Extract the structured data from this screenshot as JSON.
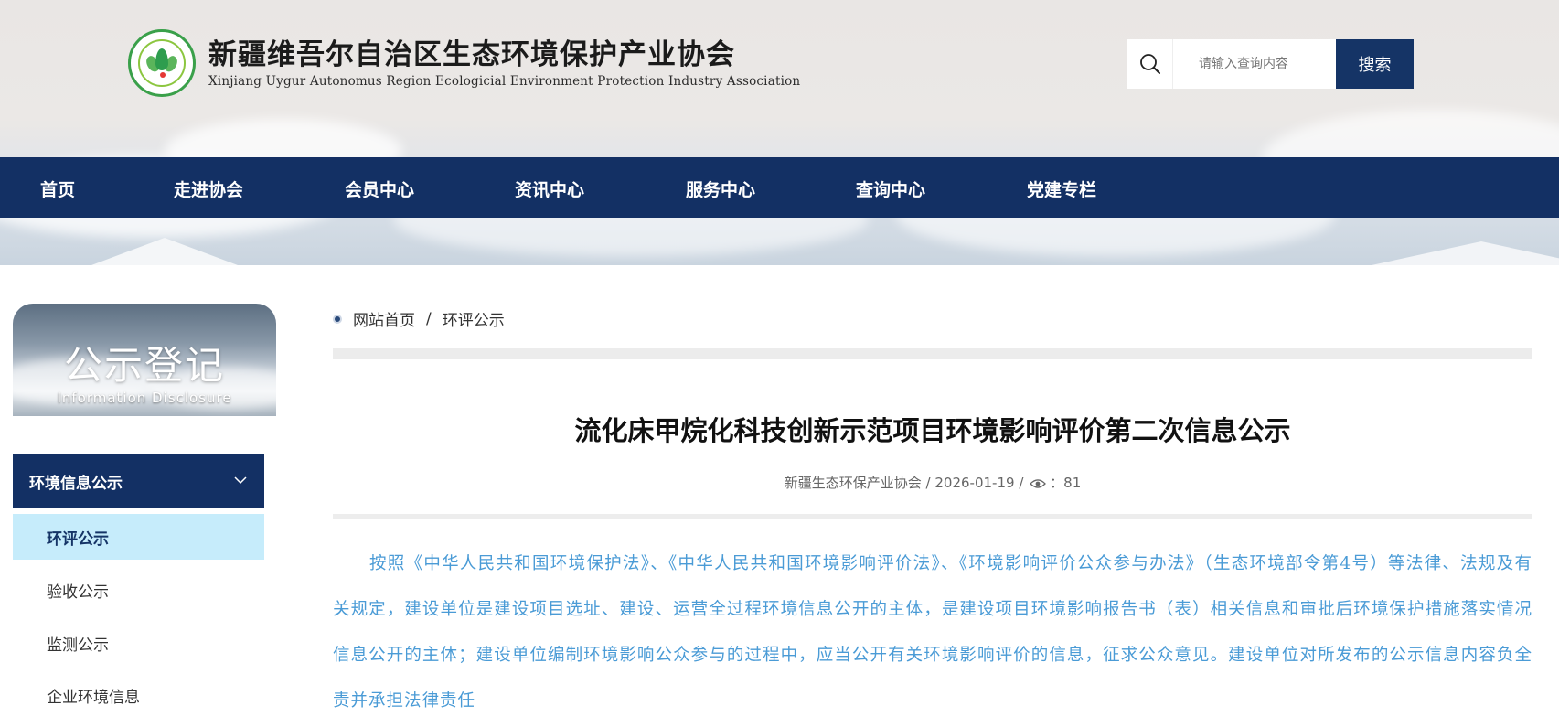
{
  "header": {
    "org_name_cn": "新疆维吾尔自治区生态环境保护产业协会",
    "org_name_en": "Xinjiang Uygur Autonomus Region Ecologicial Environment Protection Industry Association",
    "logo_ring_text": "XEEPIA",
    "search": {
      "placeholder": "请输入查询内容",
      "button_label": "搜索"
    }
  },
  "nav": {
    "items": [
      {
        "label": "首页"
      },
      {
        "label": "走进协会"
      },
      {
        "label": "会员中心"
      },
      {
        "label": "资讯中心"
      },
      {
        "label": "服务中心"
      },
      {
        "label": "查询中心"
      },
      {
        "label": "党建专栏"
      }
    ]
  },
  "sidebar": {
    "hero_title": "公示登记",
    "hero_subtitle": "Information Disclosure",
    "section_label": "环境信息公示",
    "items": [
      {
        "label": "环评公示",
        "active": true
      },
      {
        "label": "验收公示",
        "active": false
      },
      {
        "label": "监测公示",
        "active": false
      },
      {
        "label": "企业环境信息",
        "active": false
      }
    ]
  },
  "breadcrumb": {
    "home": "网站首页",
    "separator": "/",
    "current": "环评公示"
  },
  "article": {
    "title": "流化床甲烷化科技创新示范项目环境影响评价第二次信息公示",
    "source": "新疆生态环保产业协会",
    "meta_sep": "/",
    "date": "2026-01-19",
    "views_label": "：81",
    "body": "按照《中华人民共和国环境保护法》、《中华人民共和国环境影响评价法》、《环境影响评价公众参与办法》（生态环境部令第4号）等法律、法规及有关规定，建设单位是建设项目选址、建设、运营全过程环境信息公开的主体，是建设项目环境影响报告书（表）相关信息和审批后环境保护措施落实情况信息公开的主体；建设单位编制环境影响公众参与的过程中，应当公开有关环境影响评价的信息，征求公众意见。建设单位对所发布的公示信息内容负全责并承担法律责任"
  },
  "colors": {
    "nav_bg": "#133064",
    "active_item_bg": "#c6ecfb",
    "body_text": "#4a9bd6"
  }
}
